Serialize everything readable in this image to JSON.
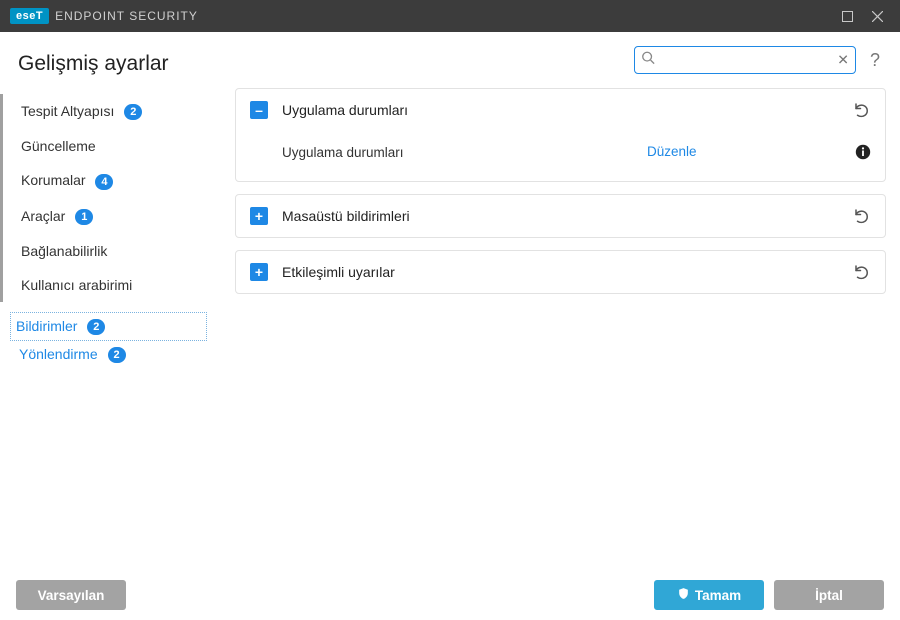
{
  "titlebar": {
    "brand_badge": "eseT",
    "product": "ENDPOINT SECURITY"
  },
  "page_title": "Gelişmiş ayarlar",
  "sidebar": {
    "items": [
      {
        "label": "Tespit Altyapısı",
        "badge": "2"
      },
      {
        "label": "Güncelleme",
        "badge": ""
      },
      {
        "label": "Korumalar",
        "badge": "4"
      },
      {
        "label": "Araçlar",
        "badge": "1"
      },
      {
        "label": "Bağlanabilirlik",
        "badge": ""
      },
      {
        "label": "Kullanıcı arabirimi",
        "badge": ""
      }
    ],
    "sub": [
      {
        "label": "Bildirimler",
        "badge": "2"
      },
      {
        "label": "Yönlendirme",
        "badge": "2"
      }
    ]
  },
  "search": {
    "placeholder": ""
  },
  "panels": [
    {
      "title": "Uygulama durumları",
      "expanded": true,
      "rows": [
        {
          "label": "Uygulama durumları",
          "action": "Düzenle"
        }
      ]
    },
    {
      "title": "Masaüstü bildirimleri",
      "expanded": false
    },
    {
      "title": "Etkileşimli uyarılar",
      "expanded": false
    }
  ],
  "footer": {
    "default": "Varsayılan",
    "ok": "Tamam",
    "cancel": "İptal"
  }
}
